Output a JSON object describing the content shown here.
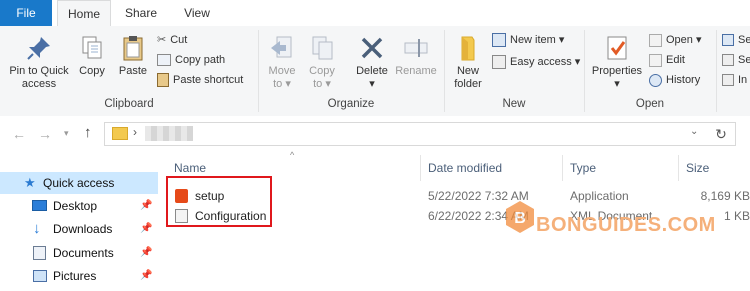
{
  "tabs": [
    {
      "label": "File"
    },
    {
      "label": "Home"
    },
    {
      "label": "Share"
    },
    {
      "label": "View"
    }
  ],
  "clipboard": {
    "pin_label_1": "Pin to Quick",
    "pin_label_2": "access",
    "copy_label": "Copy",
    "paste_label": "Paste",
    "cut_label": "Cut",
    "copy_path_label": "Copy path",
    "paste_shortcut_label": "Paste shortcut",
    "group_label": "Clipboard"
  },
  "organize": {
    "move_to_label_1": "Move",
    "move_to_label_2": "to",
    "copy_to_label_1": "Copy",
    "copy_to_label_2": "to",
    "delete_label": "Delete",
    "rename_label": "Rename",
    "group_label": "Organize"
  },
  "new": {
    "new_folder_label_1": "New",
    "new_folder_label_2": "folder",
    "new_item_label": "New item",
    "easy_access_label": "Easy access",
    "group_label": "New"
  },
  "open": {
    "properties_label": "Properties",
    "open_label": "Open",
    "edit_label": "Edit",
    "history_label": "History",
    "group_label": "Open"
  },
  "select": {
    "item1": "Se",
    "item2": "Se",
    "item3": "In"
  },
  "sidebar": {
    "items": [
      {
        "label": "Quick access",
        "icon": "star-icon"
      },
      {
        "label": "Desktop",
        "icon": "desktop-icon"
      },
      {
        "label": "Downloads",
        "icon": "download-icon"
      },
      {
        "label": "Documents",
        "icon": "documents-icon"
      },
      {
        "label": "Pictures",
        "icon": "pictures-icon"
      }
    ]
  },
  "columns": {
    "name": "Name",
    "date": "Date modified",
    "type": "Type",
    "size": "Size"
  },
  "files": [
    {
      "name": "setup",
      "date": "5/22/2022 7:32 AM",
      "type": "Application",
      "size": "8,169 KB"
    },
    {
      "name": "Configuration",
      "date": "6/22/2022 2:34 AM",
      "type": "XML Document",
      "size": "1 KB"
    }
  ],
  "watermark": {
    "text": "BONGUIDES.COM"
  },
  "colors": {
    "accent": "#1979ca",
    "highlight": "#e0181c",
    "watermark": "#f28c3b"
  }
}
